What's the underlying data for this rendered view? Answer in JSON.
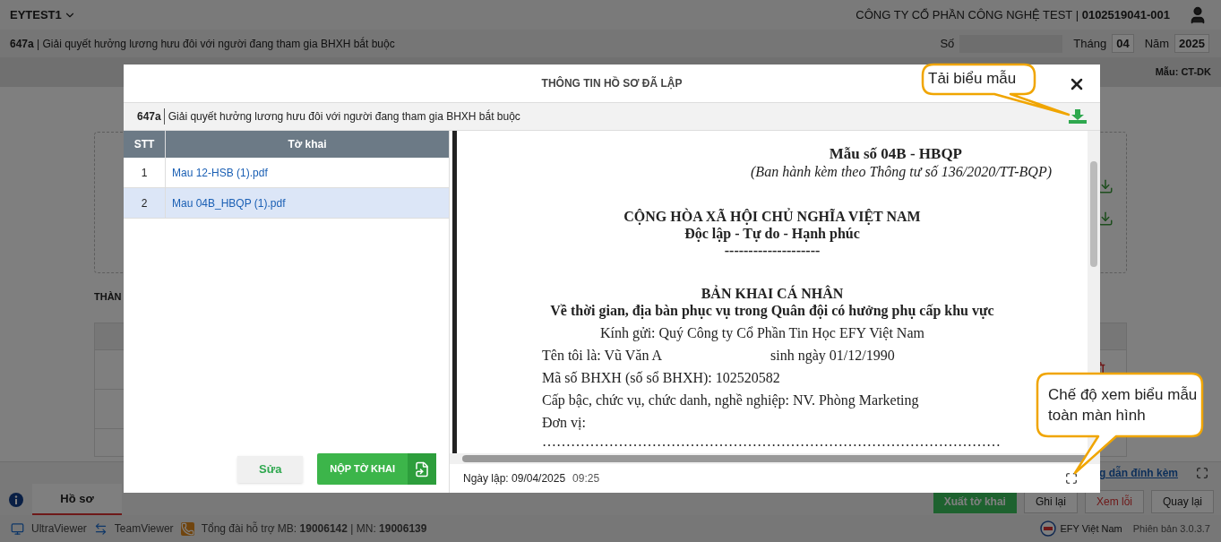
{
  "header": {
    "workspace": "EYTEST1",
    "company": "CÔNG TY CỔ PHẦN CÔNG NGHỆ TEST | **0102519041-001**"
  },
  "procedure": {
    "code": "647a",
    "separator": "|",
    "title": "Giải quyết hưởng lương hưu đôi với người đang tham gia BHXH bắt buộc"
  },
  "period": {
    "number_label": "Số",
    "month_label": "Tháng",
    "month": "04",
    "year_label": "Năm",
    "year": "2025"
  },
  "template": "Mẫu: CT-DK",
  "section_heading": "THÀN",
  "attachment_link": "g dẫn đính kèm",
  "tabs": [
    {
      "label": "Hồ sơ",
      "selected": true
    }
  ],
  "actions": [
    {
      "label": "Xuất tờ khai",
      "kind": "primary"
    },
    {
      "label": "Ghi lại",
      "kind": "default"
    },
    {
      "label": "Xem lỗi",
      "kind": "danger"
    },
    {
      "label": "Quay lại",
      "kind": "default"
    }
  ],
  "footer": {
    "tools": [
      {
        "label": "UltraViewer",
        "kind": "monitor"
      },
      {
        "label": "TeamViewer",
        "kind": "remote"
      }
    ],
    "hotline": "Tổng đài hỗ trợ MB: **19006142** | MN: **19006139**",
    "brand": "EFY Việt Nam",
    "version": "Phiên bản 3.0.3.7"
  },
  "modal": {
    "title": "THÔNG TIN HỒ SƠ ĐÃ LẬP",
    "code": "647a",
    "procedure": "Giải quyết hưởng lương hưu đôi với người đang tham gia BHXH bắt buộc",
    "columns": [
      "STT",
      "Tờ khai"
    ],
    "rows": [
      {
        "stt": "1",
        "file": "Mau 12-HSB (1).pdf",
        "selected": false
      },
      {
        "stt": "2",
        "file": "Mau 04B_HBQP (1).pdf",
        "selected": true
      }
    ],
    "edit_button": "Sửa",
    "submit_button": "NỘP TỜ KHAI",
    "created": "Ngày lập: 09/04/2025",
    "time": "09:25",
    "document": [
      {
        "kind": "form-number",
        "text": "Mẫu số 04B - HBQP"
      },
      {
        "kind": "issuance",
        "text": "(Ban hành kèm theo Thông tư số 136/2020/TT-BQP)"
      },
      {
        "kind": "nation",
        "text": "CỘNG HÒA XÃ HỘI CHỦ NGHĨA VIỆT NAM"
      },
      {
        "kind": "motto",
        "text": "Độc lập - Tự do - Hạnh phúc"
      },
      {
        "kind": "motto",
        "text": "--------------------"
      },
      {
        "kind": "title",
        "text": "BẢN KHAI CÁ NHÂN"
      },
      {
        "kind": "subtitle",
        "text": "Về thời gian, địa bàn phục vụ trong Quân đội có hưởng phụ cấp khu vực"
      },
      {
        "kind": "addressee",
        "text": "Kính gửi: Quý Công ty Cổ Phần Tin Học EFY Việt Nam"
      },
      {
        "kind": "pair",
        "text": "Tên tôi là: Vũ Văn A",
        "extra": "sinh ngày 01/12/1990"
      },
      {
        "kind": "field",
        "text": "Mã số BHXH (số sổ BHXH): 102520582"
      },
      {
        "kind": "field",
        "text": "Cấp bậc, chức vụ, chức danh, nghề nghiệp: NV. Phòng Marketing"
      },
      {
        "kind": "field",
        "text": "Đơn vị:"
      },
      {
        "kind": "dots",
        "text": "……………………………………………………………………………………"
      }
    ]
  },
  "callouts": [
    {
      "text": "Tải biểu mẫu",
      "kind": "download"
    },
    {
      "text": "Chế độ xem biểu mẫu toàn màn hình",
      "kind": "fullscreen"
    }
  ]
}
